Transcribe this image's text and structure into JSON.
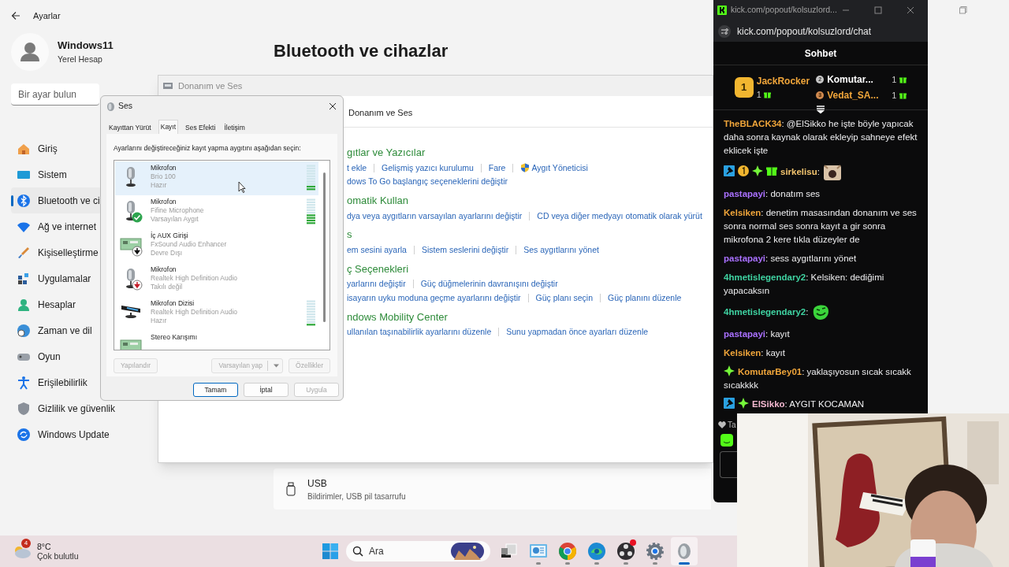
{
  "settings": {
    "app_title": "Ayarlar",
    "user": {
      "name": "Windows11",
      "account": "Yerel Hesap"
    },
    "search": {
      "placeholder": "Bir ayar bulun"
    },
    "nav": [
      {
        "label": "Giriş",
        "selected": false
      },
      {
        "label": "Sistem",
        "selected": false
      },
      {
        "label": "Bluetooth ve ci",
        "selected": true
      },
      {
        "label": "Ağ ve internet",
        "selected": false
      },
      {
        "label": "Kişiselleştirme",
        "selected": false
      },
      {
        "label": "Uygulamalar",
        "selected": false
      },
      {
        "label": "Hesaplar",
        "selected": false
      },
      {
        "label": "Zaman ve dil",
        "selected": false
      },
      {
        "label": "Oyun",
        "selected": false
      },
      {
        "label": "Erişilebilirlik",
        "selected": false
      },
      {
        "label": "Gizlilik ve güvenlik",
        "selected": false
      },
      {
        "label": "Windows Update",
        "selected": false
      }
    ],
    "page_title": "Bluetooth ve cihazlar",
    "cards": [
      {
        "title": "USB",
        "subtitle": "Bildirimler, USB pil tasarrufu"
      }
    ]
  },
  "control_panel": {
    "title": "Donanım ve Ses",
    "breadcrumb": "Donanım ve Ses",
    "sections": [
      {
        "heading": "gıtlar ve Yazıcılar",
        "rows": [
          [
            {
              "text": "t ekle",
              "shield": false
            },
            {
              "text": "Gelişmiş yazıcı kurulumu",
              "shield": false
            },
            {
              "text": "Fare",
              "shield": false
            },
            {
              "text": "Aygıt Yöneticisi",
              "shield": true
            }
          ],
          [
            {
              "text": "dows To Go başlangıç seçeneklerini değiştir",
              "shield": false
            }
          ]
        ]
      },
      {
        "heading": "omatik Kullan",
        "rows": [
          [
            {
              "text": "dya veya aygıtların varsayılan ayarlarını değiştir",
              "shield": false
            },
            {
              "text": "CD veya diğer medyayı otomatik olarak yürüt",
              "shield": false
            }
          ]
        ]
      },
      {
        "heading": "s",
        "rows": [
          [
            {
              "text": "em sesini ayarla",
              "shield": false
            },
            {
              "text": "Sistem seslerini değiştir",
              "shield": false
            },
            {
              "text": "Ses aygıtlarını yönet",
              "shield": false
            }
          ]
        ]
      },
      {
        "heading": "ç Seçenekleri",
        "rows": [
          [
            {
              "text": "yarlarını değiştir",
              "shield": false
            },
            {
              "text": "Güç düğmelerinin davranışını değiştir",
              "shield": false
            }
          ],
          [
            {
              "text": "isayarın uyku moduna geçme ayarlarını değiştir",
              "shield": false
            },
            {
              "text": "Güç planı seçin",
              "shield": false
            },
            {
              "text": "Güç planını düzenle",
              "shield": false
            }
          ]
        ]
      },
      {
        "heading": "ndows Mobility Center",
        "rows": [
          [
            {
              "text": "ullanılan taşınabilirlik ayarlarını düzenle",
              "shield": false
            },
            {
              "text": "Sunu yapmadan önce ayarları düzenle",
              "shield": false
            }
          ]
        ]
      }
    ]
  },
  "sound_dialog": {
    "title": "Ses",
    "tabs": [
      {
        "label": "Kayıttan Yürüt",
        "selected": false
      },
      {
        "label": "Kayıt",
        "selected": true
      },
      {
        "label": "Ses Efekti",
        "selected": false
      },
      {
        "label": "İletişim",
        "selected": false
      }
    ],
    "instruction": "Ayarlarını değiştireceğiniz kayıt yapma aygıtını aşağıdan seçin:",
    "devices": [
      {
        "kind": "microphone",
        "name": "Mikrofon",
        "driver": "Brio 100",
        "status": "Hazır",
        "default": false,
        "disabled": false,
        "unplugged": false,
        "level": 0.2,
        "selected": true
      },
      {
        "kind": "microphone",
        "name": "Mikrofon",
        "driver": "Fifine Microphone",
        "status": "Varsayılan Aygıt",
        "default": true,
        "disabled": false,
        "unplugged": false,
        "level": 0.4,
        "selected": false
      },
      {
        "kind": "board",
        "name": "İç AUX Girişi",
        "driver": "FxSound Audio Enhancer",
        "status": "Devre Dışı",
        "default": false,
        "disabled": true,
        "unplugged": false,
        "selected": false
      },
      {
        "kind": "microphone",
        "name": "Mikrofon",
        "driver": "Realtek High Definition Audio",
        "status": "Takılı değil",
        "default": false,
        "disabled": false,
        "unplugged": true,
        "selected": false
      },
      {
        "kind": "array",
        "name": "Mikrofon Dizisi",
        "driver": "Realtek High Definition Audio",
        "status": "Hazır",
        "default": false,
        "disabled": false,
        "unplugged": false,
        "level": 0.1,
        "selected": false
      },
      {
        "kind": "board",
        "name": "Stereo Karışımı",
        "default": false,
        "disabled": false,
        "unplugged": false,
        "selected": false
      }
    ],
    "buttons": [
      {
        "label": "Yapılandır",
        "kind": "plain",
        "disabled": true
      },
      {
        "label": "Varsayılan yap",
        "kind": "split",
        "disabled": true
      },
      {
        "label": "Özellikler",
        "kind": "plain",
        "disabled": true
      }
    ],
    "footer_buttons": [
      {
        "label": "Tamam",
        "disabled": false,
        "default": true
      },
      {
        "label": "İptal",
        "disabled": false,
        "default": false
      },
      {
        "label": "Uygula",
        "disabled": true,
        "default": false
      }
    ]
  },
  "chat": {
    "window_title": "kick.com/popout/kolsuzlord...",
    "url": "kick.com/popout/kolsuzlord/chat",
    "header": "Sohbet",
    "leaders": [
      {
        "rank": "1",
        "name": "JackRocker",
        "count": "1",
        "color": "#f0a53a"
      },
      {
        "rank": "2",
        "name": "Komutar...",
        "count": "1",
        "color": "#ffffff"
      },
      {
        "rank": "3",
        "name": "Vedat_SA...",
        "count": "1",
        "color": "#f0a53a"
      }
    ],
    "messages": [
      {
        "kind": "text",
        "user": "TheBLACK34",
        "color": "#f0a53a",
        "moderator": false,
        "subscriber": false,
        "vip": false,
        "gifter": false,
        "text": ": @ElSikko he işte böyle yapıcak daha sonra kaynak olarak ekleyip sahneye efekt eklicek işte"
      },
      {
        "kind": "cat",
        "user": "sirkelisu",
        "color": "#f3c46e",
        "moderator": true,
        "subscriber": true,
        "vip": true,
        "gifter": true,
        "text": ":"
      },
      {
        "kind": "text",
        "user": "pastapayi",
        "color": "#a970ff",
        "moderator": false,
        "subscriber": false,
        "vip": false,
        "gifter": false,
        "text": ": donatım ses"
      },
      {
        "kind": "text",
        "user": "Kelsiken",
        "color": "#f0a53a",
        "moderator": false,
        "subscriber": false,
        "vip": false,
        "gifter": false,
        "text": ": denetim masasından donanım ve ses sonra normal ses sonra kayıt a gir sonra mikrofona 2 kere tıkla düzeyler de"
      },
      {
        "kind": "text",
        "user": "pastapayi",
        "color": "#a970ff",
        "moderator": false,
        "subscriber": false,
        "vip": false,
        "gifter": false,
        "text": ": sess aygıtlarını yönet"
      },
      {
        "kind": "text",
        "user": "4hmetislegendary2",
        "color": "#3fd3a2",
        "moderator": false,
        "subscriber": false,
        "vip": false,
        "gifter": false,
        "text": ": Kelsiken: dediğimi yapacaksın"
      },
      {
        "kind": "laugh",
        "user": "4hmetislegendary2",
        "color": "#3fd3a2",
        "moderator": false,
        "subscriber": false,
        "vip": false,
        "gifter": false,
        "text": ":"
      },
      {
        "kind": "text",
        "user": "pastapayi",
        "color": "#a970ff",
        "moderator": false,
        "subscriber": false,
        "vip": false,
        "gifter": false,
        "text": ": kayıt"
      },
      {
        "kind": "text",
        "user": "Kelsiken",
        "color": "#f0a53a",
        "moderator": false,
        "subscriber": false,
        "vip": false,
        "gifter": false,
        "text": ": kayıt"
      },
      {
        "kind": "text",
        "user": "KomutarBey01",
        "color": "#f0a53a",
        "moderator": false,
        "subscriber": false,
        "vip": true,
        "gifter": false,
        "text": ": yaklaşıyosun sıcak sıcakk sıcakkkk"
      },
      {
        "kind": "text",
        "user": "ElSikko",
        "color": "#f2b8d0",
        "moderator": true,
        "subscriber": false,
        "vip": true,
        "gifter": false,
        "text": ": AYGIT KOCAMAN"
      }
    ],
    "footer": "Ta"
  },
  "taskbar": {
    "weather": {
      "badge": "4",
      "temp": "8°C",
      "condition": "Çok bulutlu"
    },
    "search_placeholder": "Ara",
    "apps": [
      {
        "running": false,
        "selected": false,
        "notification": false
      },
      {
        "running": true,
        "selected": false,
        "notification": false
      },
      {
        "running": true,
        "selected": false,
        "notification": false
      },
      {
        "running": true,
        "selected": false,
        "notification": false
      },
      {
        "running": true,
        "selected": false,
        "notification": true
      },
      {
        "running": true,
        "selected": false,
        "notification": false
      },
      {
        "running": true,
        "selected": true,
        "notification": false
      }
    ]
  }
}
